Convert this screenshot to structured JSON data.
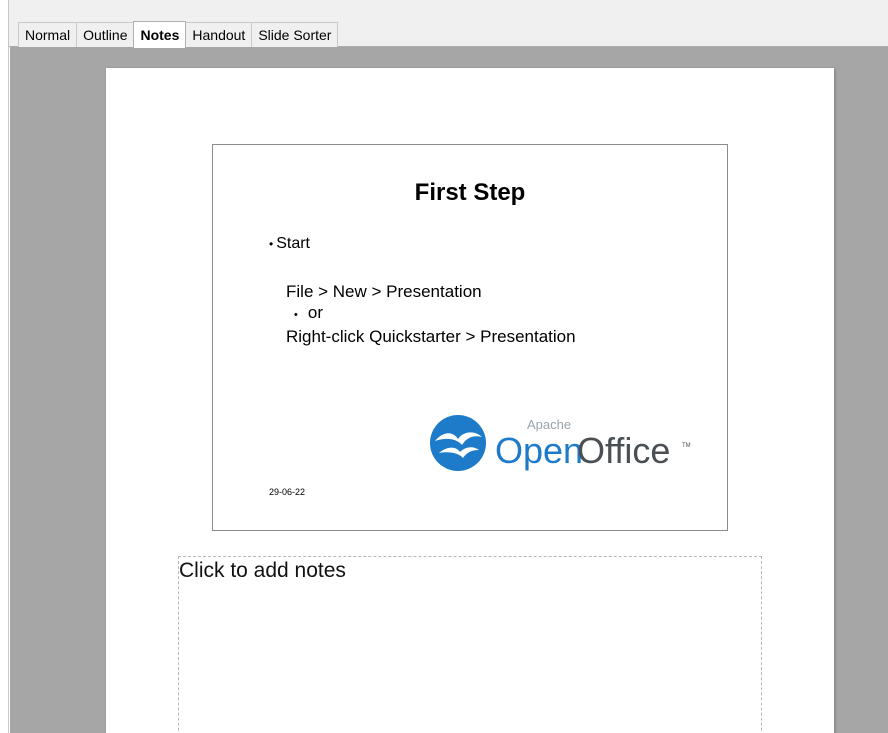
{
  "view_tabs": [
    {
      "label": "Normal",
      "active": false
    },
    {
      "label": "Outline",
      "active": false
    },
    {
      "label": "Notes",
      "active": true
    },
    {
      "label": "Handout",
      "active": false
    },
    {
      "label": "Slide Sorter",
      "active": false
    }
  ],
  "slide": {
    "title": "First Step",
    "bullet": "Start",
    "line1": "File > New > Presentation",
    "line2": "or",
    "line3": "Right-click Quickstarter > Presentation",
    "date": "29-06-22",
    "logo": {
      "small_text": "Apache",
      "main_text_a": "Open",
      "main_text_b": "Office",
      "trademark": "TM",
      "color": "#1e7bc9"
    }
  },
  "notes": {
    "placeholder": "Click to add notes"
  },
  "colors": {
    "workspace": "#a6a6a6",
    "tabbar": "#f0f0f0"
  }
}
